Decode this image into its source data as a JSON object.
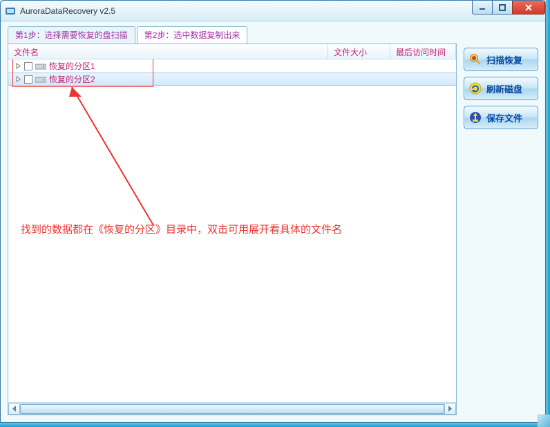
{
  "window": {
    "title": "AuroraDataRecovery v2.5"
  },
  "tabs": {
    "step1": "第1步：选择需要恢复的盘扫描",
    "step2": "第2步：选中数据复制出来"
  },
  "columns": {
    "name": "文件名",
    "size": "文件大小",
    "time": "最后访问时间"
  },
  "rows": [
    {
      "label": "恢复的分区1",
      "selected": false
    },
    {
      "label": "恢复的分区2",
      "selected": true
    }
  ],
  "sidebar": {
    "scan": "扫描恢复",
    "refresh": "刷新磁盘",
    "save": "保存文件"
  },
  "annotation": {
    "text": "找到的数据都在《恢复的分区》目录中，双击可用展开看具体的文件名"
  }
}
